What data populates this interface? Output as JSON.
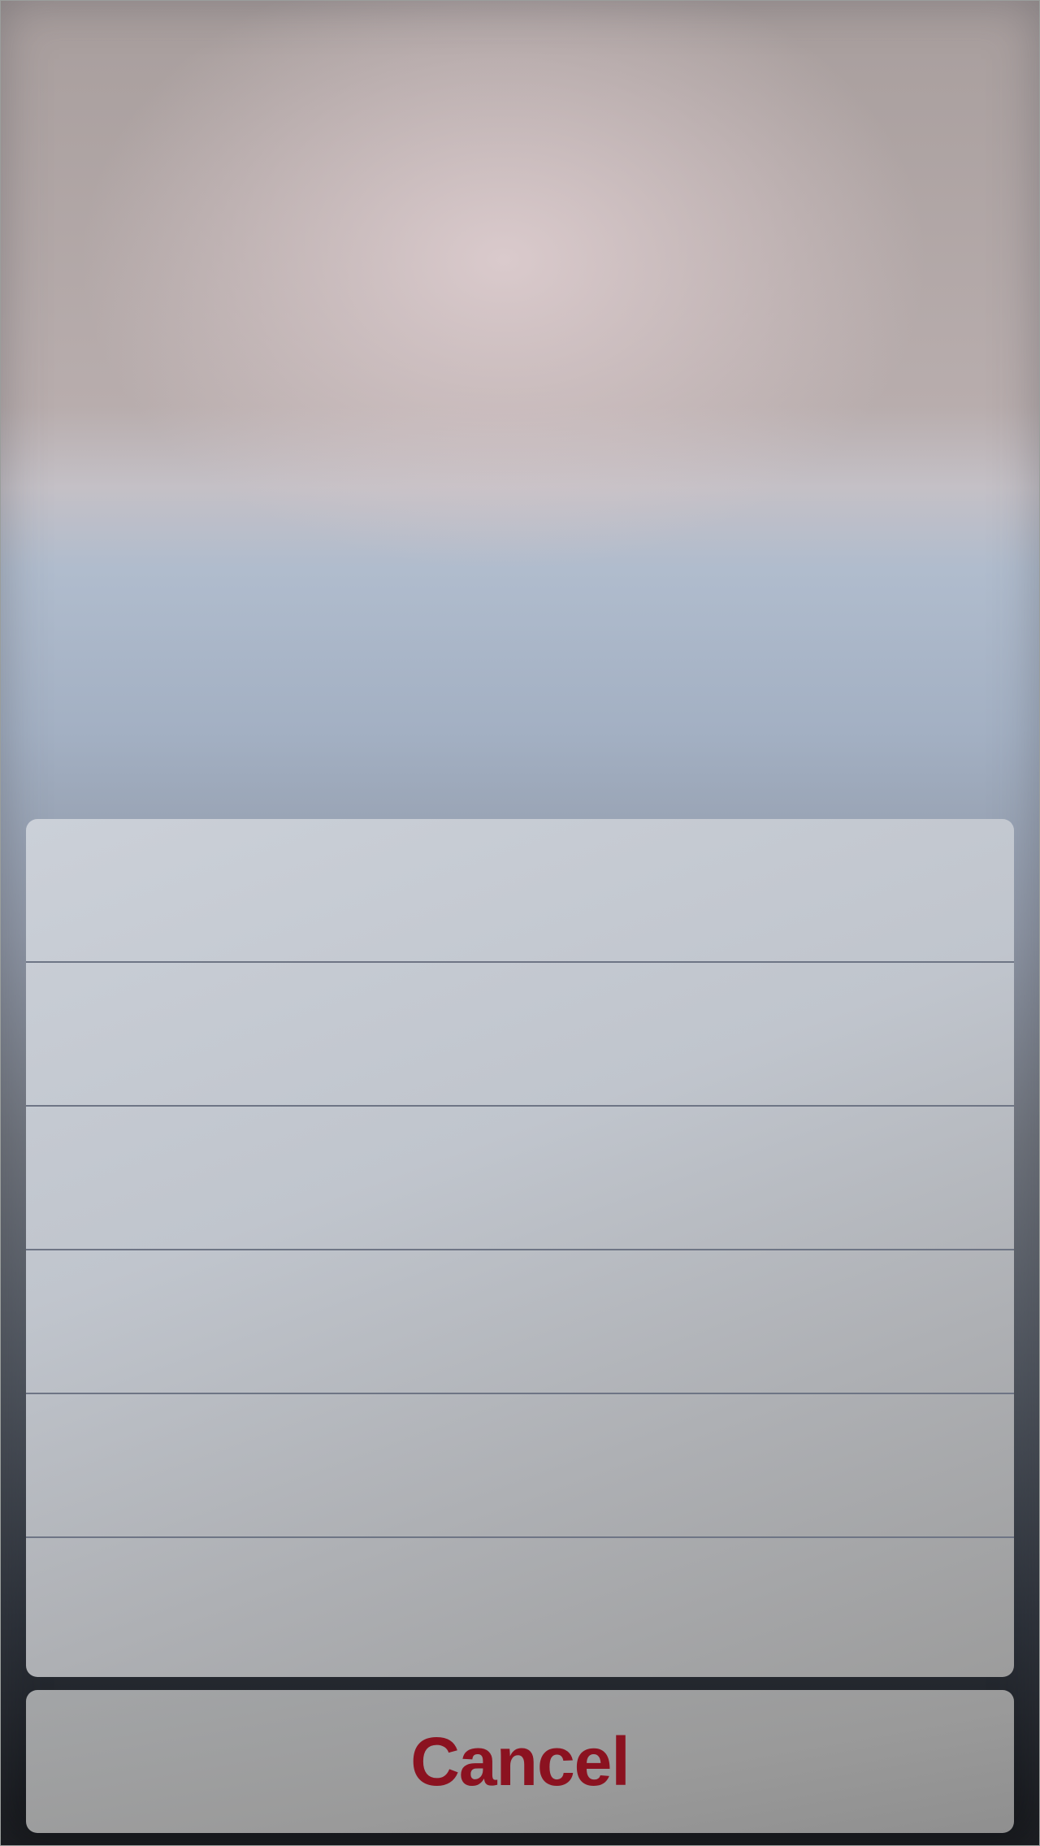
{
  "action_sheet": {
    "rows": [
      "",
      "",
      "",
      "",
      "",
      ""
    ],
    "cancel_label": "Cancel"
  },
  "colors": {
    "cancel_text": "#8b1220"
  }
}
